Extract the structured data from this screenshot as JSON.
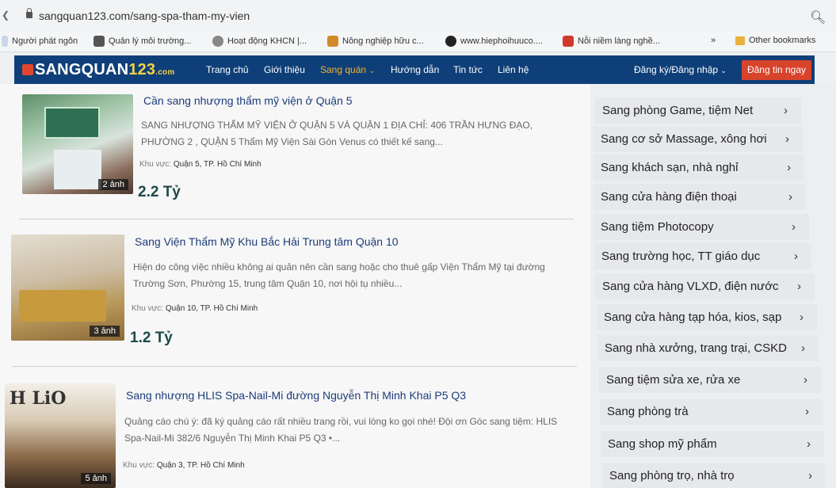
{
  "browser": {
    "url": "sangquan123.com/sang-spa-tham-my-vien",
    "bookmarks": [
      {
        "label": "Người phát ngôn"
      },
      {
        "label": "Quản lý môi trường..."
      },
      {
        "label": "Hoạt động KHCN |..."
      },
      {
        "label": "Nông nghiệp hữu c..."
      },
      {
        "label": "www.hiephoihuuco...."
      },
      {
        "label": "Nỗi niềm làng nghề..."
      },
      {
        "label": "»"
      },
      {
        "label": "Other bookmarks"
      }
    ]
  },
  "header": {
    "logo_main": "SANGQUAN",
    "logo_num": "123",
    "logo_suffix": ".com",
    "nav": [
      {
        "label": "Trang chủ"
      },
      {
        "label": "Giới thiệu"
      },
      {
        "label": "Sang quán"
      },
      {
        "label": "Hướng dẫn"
      },
      {
        "label": "Tin tức"
      },
      {
        "label": "Liên hệ"
      }
    ],
    "active_nav": "Sang quán",
    "login": "Đăng ký/Đăng nhập",
    "post_button": "Đăng tin ngay",
    "colors": {
      "bar": "#0f3f78",
      "accent": "#f5b32a",
      "button": "#d8432b"
    }
  },
  "listings": [
    {
      "title": "Cần sang nhượng thẩm mỹ viện ở Quận 5",
      "description": "SANG NHƯỢNG THẨM MỸ VIỆN Ở QUẬN 5 VÀ QUẬN 1 ĐỊA CHỈ: 406 TRẦN HƯNG ĐẠO, PHƯỜNG 2 , QUẬN 5 Thẩm Mỹ Viện Sài Gòn Venus có thiết kế sang...",
      "area_label": "Khu vực:",
      "area": "Quận 5, TP. Hồ Chí Minh",
      "price": "2.2 Tỷ",
      "photos": "2 ảnh"
    },
    {
      "title": "Sang Viện Thẩm Mỹ Khu Bắc Hải Trung tâm Quận 10",
      "description": "Hiện do công việc nhiều không ai quản nên cần sang hoặc cho thuê gấp Viện Thẩm Mỹ tại đường Trường Sơn, Phường 15, trung tâm Quận 10, nơi hội tụ nhiều...",
      "area_label": "Khu vực:",
      "area": "Quận 10, TP. Hồ Chí Minh",
      "price": "1.2 Tỷ",
      "photos": "3 ảnh"
    },
    {
      "title": "Sang nhượng HLIS Spa-Nail-Mi đường Nguyễn Thị Minh Khai P5 Q3",
      "description": "Quảng cáo chú ý: đã ký quảng cáo rất nhiều trang rồi, vui lòng ko gọi nhé! Đội ơn Góc sang tiệm: HLIS Spa-Nail-Mi 382/6 Nguyễn Thị Minh Khai P5 Q3 •...",
      "area_label": "Khu vực:",
      "area": "Quận 3, TP. Hồ Chí Minh",
      "price": "",
      "photos": "5 ảnh"
    }
  ],
  "categories": [
    {
      "label": "Sang phòng Game, tiệm Net"
    },
    {
      "label": "Sang cơ sở Massage, xông hơi"
    },
    {
      "label": "Sang khách sạn, nhà nghỉ"
    },
    {
      "label": "Sang cửa hàng điện thoại"
    },
    {
      "label": "Sang tiệm Photocopy"
    },
    {
      "label": "Sang trường học, TT giáo dục"
    },
    {
      "label": "Sang cửa hàng VLXD, điện nước"
    },
    {
      "label": "Sang cửa hàng tạp hóa, kios, sạp"
    },
    {
      "label": "Sang nhà xưởng, trang trại, CSKD"
    },
    {
      "label": "Sang tiệm sửa xe, rửa xe"
    },
    {
      "label": "Sang phòng trà"
    },
    {
      "label": "Sang shop mỹ phẩm"
    },
    {
      "label": "Sang phòng trọ, nhà trọ"
    }
  ]
}
